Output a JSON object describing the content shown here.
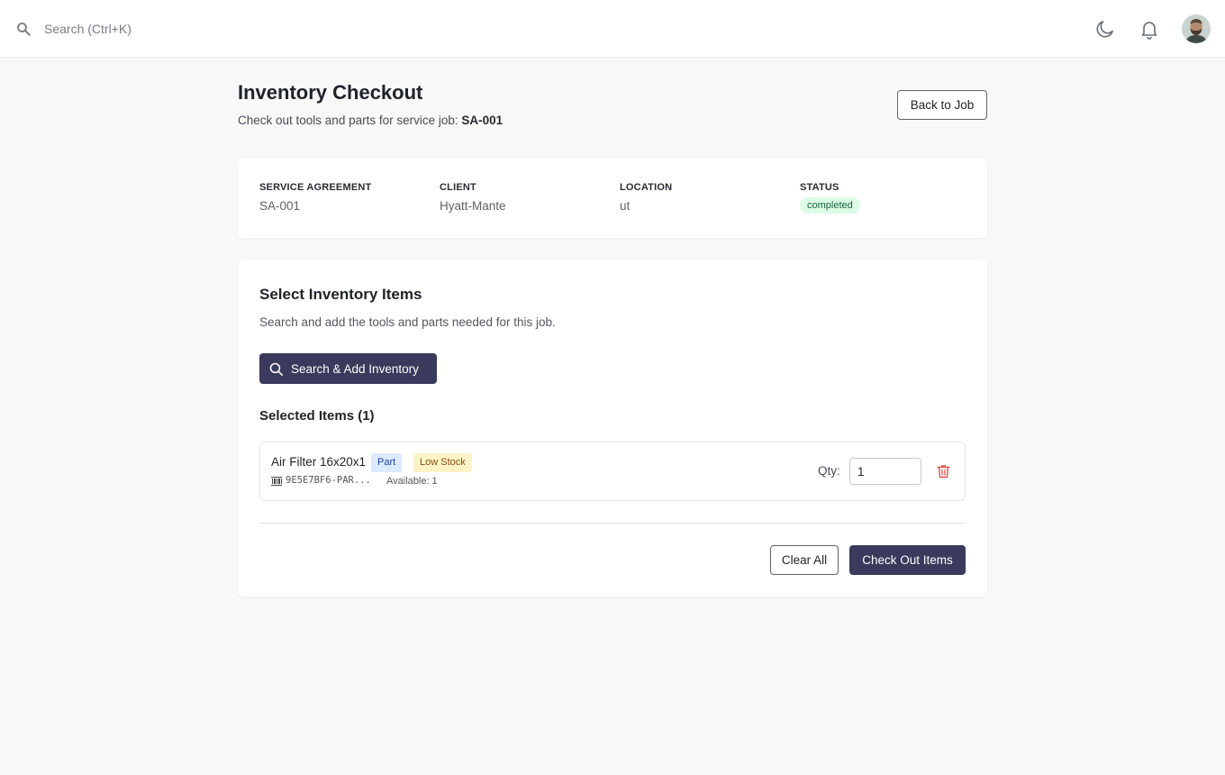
{
  "topbar": {
    "search_placeholder": "Search (Ctrl+K)",
    "icons": [
      "search-icon",
      "moon-icon",
      "bell-icon",
      "avatar"
    ]
  },
  "header": {
    "title": "Inventory Checkout",
    "subtitle_prefix": "Check out tools and parts for service job: ",
    "job_id": "SA-001",
    "back_label": "Back to Job"
  },
  "info": {
    "agreement_label": "SERVICE AGREEMENT",
    "agreement_value": "SA-001",
    "client_label": "CLIENT",
    "client_value": "Hyatt-Mante",
    "location_label": "LOCATION",
    "location_value": "ut",
    "status_label": "STATUS",
    "status_value": "completed"
  },
  "inventory": {
    "title": "Select Inventory Items",
    "description": "Search and add the tools and parts needed for this job.",
    "add_label": "Search & Add Inventory",
    "selected_title": "Selected Items (1)",
    "items": [
      {
        "name": "Air Filter 16x20x1",
        "type_badge": "Part",
        "stock_badge": "Low Stock",
        "sku": "9E5E7BF6-PAR...",
        "available": "Available: 1",
        "qty_label": "Qty:",
        "qty": "1"
      }
    ],
    "clear_label": "Clear All",
    "checkout_label": "Check Out Items"
  },
  "colors": {
    "primary": "#393a5c",
    "status_bg": "#dcfce7",
    "status_text": "#166534",
    "part_bg": "#dbeafe",
    "low_stock_bg": "#fef3c7",
    "danger": "#e05252"
  }
}
